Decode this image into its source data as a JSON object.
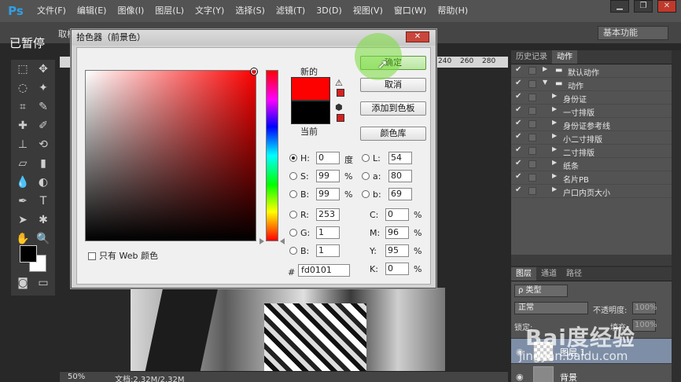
{
  "app": {
    "logo": "Ps",
    "menu": [
      "文件(F)",
      "编辑(E)",
      "图像(I)",
      "图层(L)",
      "文字(Y)",
      "选择(S)",
      "滤镜(T)",
      "3D(D)",
      "视图(V)",
      "窗口(W)",
      "帮助(H)"
    ],
    "window_buttons": [
      "▁",
      "❐",
      "✕"
    ]
  },
  "overlay": {
    "paused": "已暂停"
  },
  "options_bar": {
    "label": "取样",
    "workspace": "基本功能"
  },
  "ruler": {
    "numbers": [
      "240",
      "260",
      "280"
    ]
  },
  "status": {
    "zoom": "50%",
    "doc": "文档:2.32M/2.32M"
  },
  "dialog": {
    "title": "拾色器（前景色）",
    "new_label": "新的",
    "current_label": "当前",
    "new_color": "#fd0101",
    "current_color": "#000000",
    "buttons": {
      "ok": "确定",
      "cancel": "取消",
      "add_to_swatches": "添加到色板",
      "color_libraries": "颜色库"
    },
    "web_only": "只有 Web 颜色",
    "fields": {
      "H": {
        "label": "H:",
        "value": "0",
        "unit": "度"
      },
      "S": {
        "label": "S:",
        "value": "99",
        "unit": "%"
      },
      "B": {
        "label": "B:",
        "value": "99",
        "unit": "%"
      },
      "R": {
        "label": "R:",
        "value": "253"
      },
      "G": {
        "label": "G:",
        "value": "1"
      },
      "Bb": {
        "label": "B:",
        "value": "1"
      },
      "L": {
        "label": "L:",
        "value": "54"
      },
      "a": {
        "label": "a:",
        "value": "80"
      },
      "b": {
        "label": "b:",
        "value": "69"
      },
      "C": {
        "label": "C:",
        "value": "0",
        "unit": "%"
      },
      "M": {
        "label": "M:",
        "value": "96",
        "unit": "%"
      },
      "Y": {
        "label": "Y:",
        "value": "95",
        "unit": "%"
      },
      "K": {
        "label": "K:",
        "value": "0",
        "unit": "%"
      }
    },
    "hex_label": "#",
    "hex": "fd0101"
  },
  "actions_panel": {
    "tabs": [
      "历史记录",
      "动作"
    ],
    "items": [
      {
        "label": "默认动作",
        "level": 0
      },
      {
        "label": "动作",
        "level": 0
      },
      {
        "label": "身份证",
        "level": 1
      },
      {
        "label": "一寸排版",
        "level": 1
      },
      {
        "label": "身份证参考线",
        "level": 1
      },
      {
        "label": "小二寸排版",
        "level": 1
      },
      {
        "label": "二寸排版",
        "level": 1
      },
      {
        "label": "纸条",
        "level": 1
      },
      {
        "label": "名片PB",
        "level": 1
      },
      {
        "label": "户口内页大小",
        "level": 1
      }
    ]
  },
  "layers_panel": {
    "tabs": [
      "图层",
      "通道",
      "路径"
    ],
    "kind": "ρ 类型",
    "blend": "正常",
    "opacity_label": "不透明度:",
    "opacity": "100%",
    "lock_label": "锁定:",
    "fill_label": "填充:",
    "fill": "100%",
    "layers": [
      "图层 1",
      "背景"
    ]
  },
  "watermark": {
    "main": "Bai度经验",
    "sub": "jingyan.baidu.com"
  }
}
